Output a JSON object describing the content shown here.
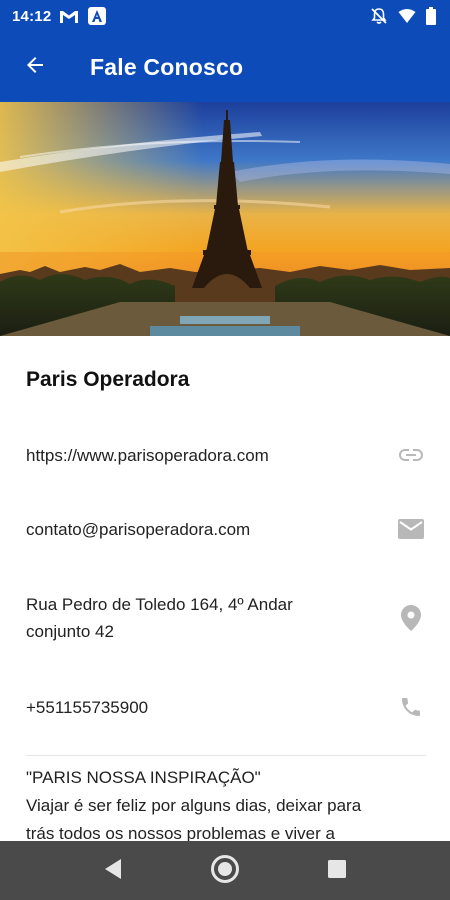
{
  "status_bar": {
    "time": "14:12",
    "icons": [
      "gmail-icon",
      "app-a-icon",
      "mute-icon",
      "wifi-icon",
      "battery-icon"
    ]
  },
  "app_bar": {
    "title": "Fale Conosco",
    "back_icon": "arrow-back-icon"
  },
  "hero": {
    "image": "Eiffel Tower at sunset"
  },
  "contact": {
    "company": "Paris Operadora",
    "website": "https://www.parisoperadora.com",
    "email": "contato@parisoperadora.com",
    "address_line1": "Rua Pedro de Toledo 164, 4º Andar",
    "address_line2": "conjunto 42",
    "phone": "+551155735900",
    "icons": {
      "website": "link-icon",
      "email": "mail-icon",
      "address": "location-pin-icon",
      "phone": "phone-icon"
    }
  },
  "description": {
    "line1": "\"PARIS NOSSA INSPIRAÇÃO\"",
    "line2": "Viajar é ser feliz por alguns dias, deixar para",
    "line3": "trás todos os nossos problemas e viver a"
  },
  "nav_bar": {
    "icons": [
      "back-triangle-icon",
      "home-circle-icon",
      "recents-square-icon"
    ]
  },
  "colors": {
    "primary": "#0d4bb8",
    "icon_gray": "#b8b8b8",
    "nav_bar": "#4a4a4a"
  }
}
